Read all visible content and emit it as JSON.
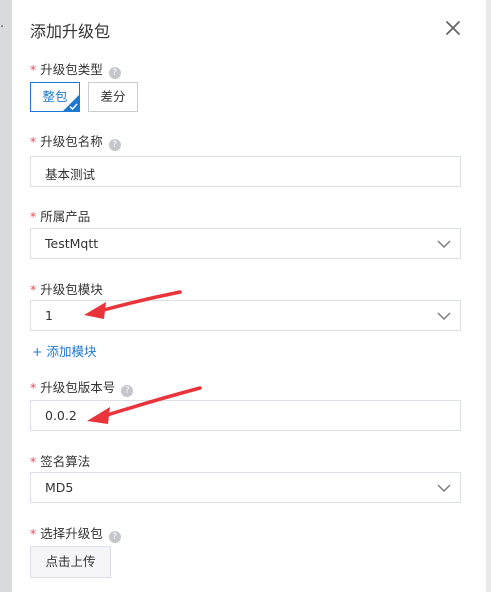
{
  "dialog": {
    "title": "添加升级包",
    "required_mark": "*"
  },
  "fields": {
    "package_type": {
      "label": "升级包类型",
      "options": [
        "整包",
        "差分"
      ],
      "selected": "整包"
    },
    "package_name": {
      "label": "升级包名称",
      "value": "基本测试"
    },
    "product": {
      "label": "所属产品",
      "value": "TestMqtt"
    },
    "module": {
      "label": "升级包模块",
      "value": "1",
      "add_link": "+ 添加模块"
    },
    "version": {
      "label": "升级包版本号",
      "value": "0.0.2"
    },
    "algorithm": {
      "label": "签名算法",
      "value": "MD5"
    },
    "upload": {
      "label": "选择升级包",
      "button": "点击上传"
    }
  },
  "colors": {
    "accent": "#1d78d1",
    "required": "#e34d59",
    "annotation_arrow": "#e8343a",
    "overlay": "#6f7479"
  },
  "icons": {
    "close": "close-icon",
    "dropdown": "chevron-down-icon",
    "help": "question-circle-icon",
    "selected": "check-icon"
  }
}
